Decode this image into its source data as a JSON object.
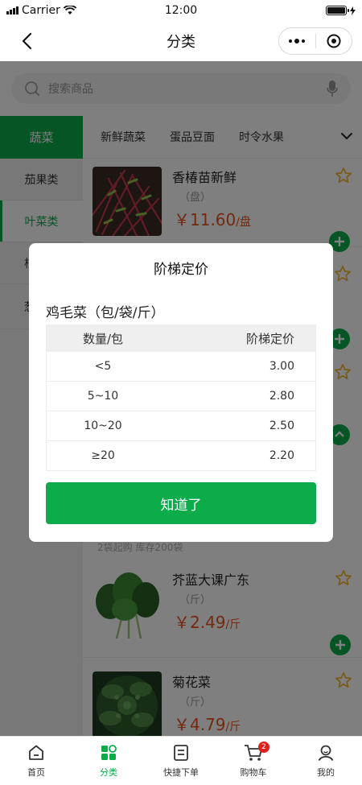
{
  "status_bar": {
    "carrier": "Carrier",
    "time": "12:00"
  },
  "nav": {
    "title": "分类"
  },
  "search": {
    "placeholder": "搜索商品"
  },
  "sidebar": {
    "top_category": "蔬菜",
    "items": [
      {
        "label": "茄果类"
      },
      {
        "label": "叶菜类"
      },
      {
        "label": "根"
      },
      {
        "label": "葱"
      }
    ]
  },
  "subtabs": [
    "新鲜蔬菜",
    "蛋品豆面",
    "时令水果"
  ],
  "products": [
    {
      "name": "香椿苗新鲜",
      "unit": "（盘）",
      "price": "￥11.60",
      "price_unit": "/盘"
    },
    {
      "name": "芥蓝大课广东",
      "unit": "（斤）",
      "price": "￥2.49",
      "price_unit": "/斤"
    },
    {
      "name": "菊花菜",
      "unit": "（斤）",
      "price": "￥4.79",
      "price_unit": "/斤"
    }
  ],
  "partial_note": "2袋起购 库存200袋",
  "modal": {
    "title": "阶梯定价",
    "product_name": "鸡毛菜（包/袋/斤）",
    "headers": {
      "qty": "数量/包",
      "price": "阶梯定价"
    },
    "rows": [
      {
        "qty": "<5",
        "price": "3.00"
      },
      {
        "qty": "5~10",
        "price": "2.80"
      },
      {
        "qty": "10~20",
        "price": "2.50"
      },
      {
        "qty": "≥20",
        "price": "2.20"
      }
    ],
    "confirm_label": "知道了"
  },
  "tabbar": {
    "items": [
      {
        "label": "首页",
        "icon": "home-icon"
      },
      {
        "label": "分类",
        "icon": "category-icon"
      },
      {
        "label": "快捷下单",
        "icon": "quick-order-icon"
      },
      {
        "label": "购物车",
        "icon": "cart-icon"
      },
      {
        "label": "我的",
        "icon": "profile-icon"
      }
    ],
    "cart_count": "2",
    "active": 1
  },
  "colors": {
    "primary": "#0dac4b",
    "price": "#e8531f",
    "star": "#f0b429",
    "badge": "#e0201c"
  }
}
